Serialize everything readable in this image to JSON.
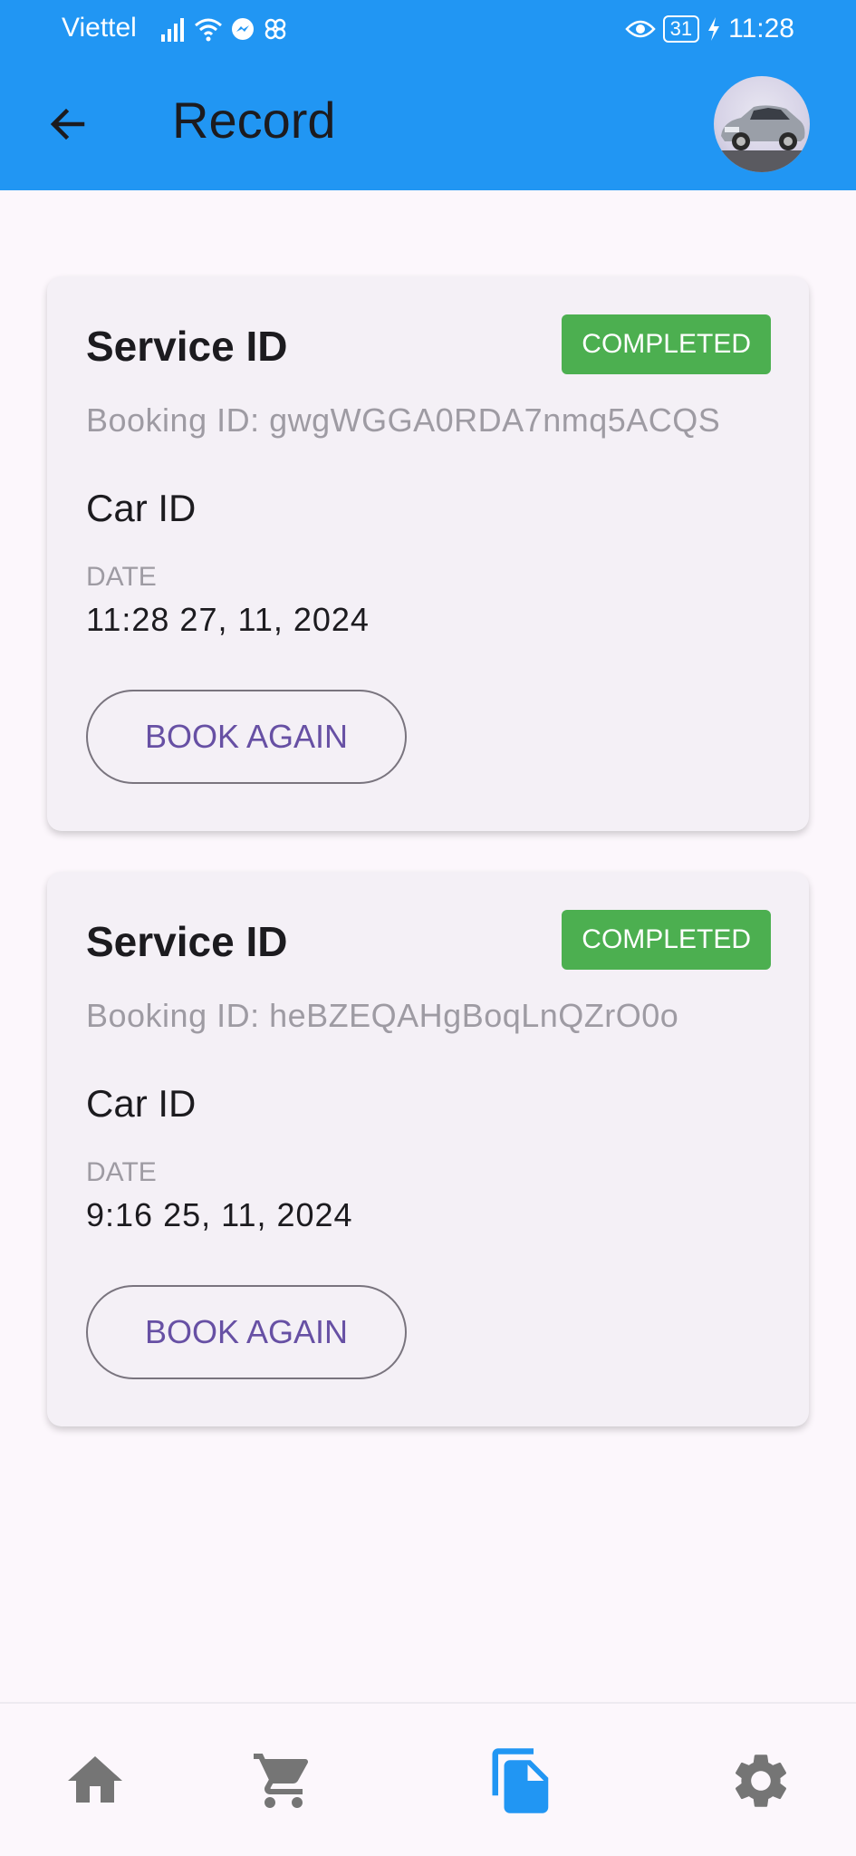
{
  "status_bar": {
    "carrier": "Viettel",
    "battery": "31",
    "time": "11:28"
  },
  "app_bar": {
    "title": "Record"
  },
  "records": [
    {
      "title": "Service ID",
      "status": "COMPLETED",
      "booking_id": "Booking ID: gwgWGGA0RDA7nmq5ACQS",
      "car_id": "Car ID",
      "date_label": "DATE",
      "date_value": "11:28  27, 11, 2024",
      "action_label": "BOOK AGAIN"
    },
    {
      "title": "Service ID",
      "status": "COMPLETED",
      "booking_id": "Booking ID: heBZEQAHgBoqLnQZrO0o",
      "car_id": "Car ID",
      "date_label": "DATE",
      "date_value": "9:16  25, 11, 2024",
      "action_label": "BOOK AGAIN"
    }
  ],
  "bottom_nav": {
    "items": [
      "home-icon",
      "cart-icon",
      "document-icon",
      "gear-icon"
    ],
    "active": "document-icon"
  },
  "colors": {
    "primary": "#2196f3",
    "badge": "#4caf50",
    "button_text": "#6750a4",
    "nav_inactive": "#757575"
  }
}
